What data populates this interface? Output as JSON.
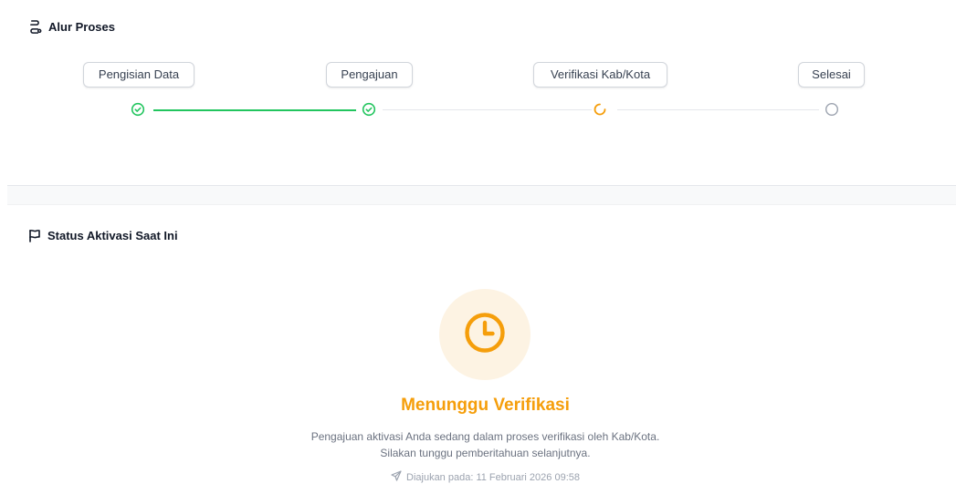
{
  "process": {
    "title": "Alur Proses",
    "icon": "route-icon",
    "steps": [
      {
        "label": "Pengisian Data",
        "state": "done"
      },
      {
        "label": "Pengajuan",
        "state": "done"
      },
      {
        "label": "Verifikasi Kab/Kota",
        "state": "in-progress"
      },
      {
        "label": "Selesai",
        "state": "pending"
      }
    ]
  },
  "status": {
    "title": "Status Aktivasi Saat Ini",
    "icon": "flag-icon",
    "state_icon": "clock-icon",
    "heading": "Menunggu Verifikasi",
    "line1": "Pengajuan aktivasi Anda sedang dalam proses verifikasi oleh Kab/Kota.",
    "line2": "Silakan tunggu pemberitahuan selanjutnya.",
    "submitted_icon": "send-icon",
    "submitted": "Diajukan pada: 11 Februari 2026 09:58"
  },
  "colors": {
    "done": "#22c55e",
    "in_progress": "#f59e0b",
    "pending": "#9ca3af",
    "status_bg": "#fdf3e3"
  }
}
